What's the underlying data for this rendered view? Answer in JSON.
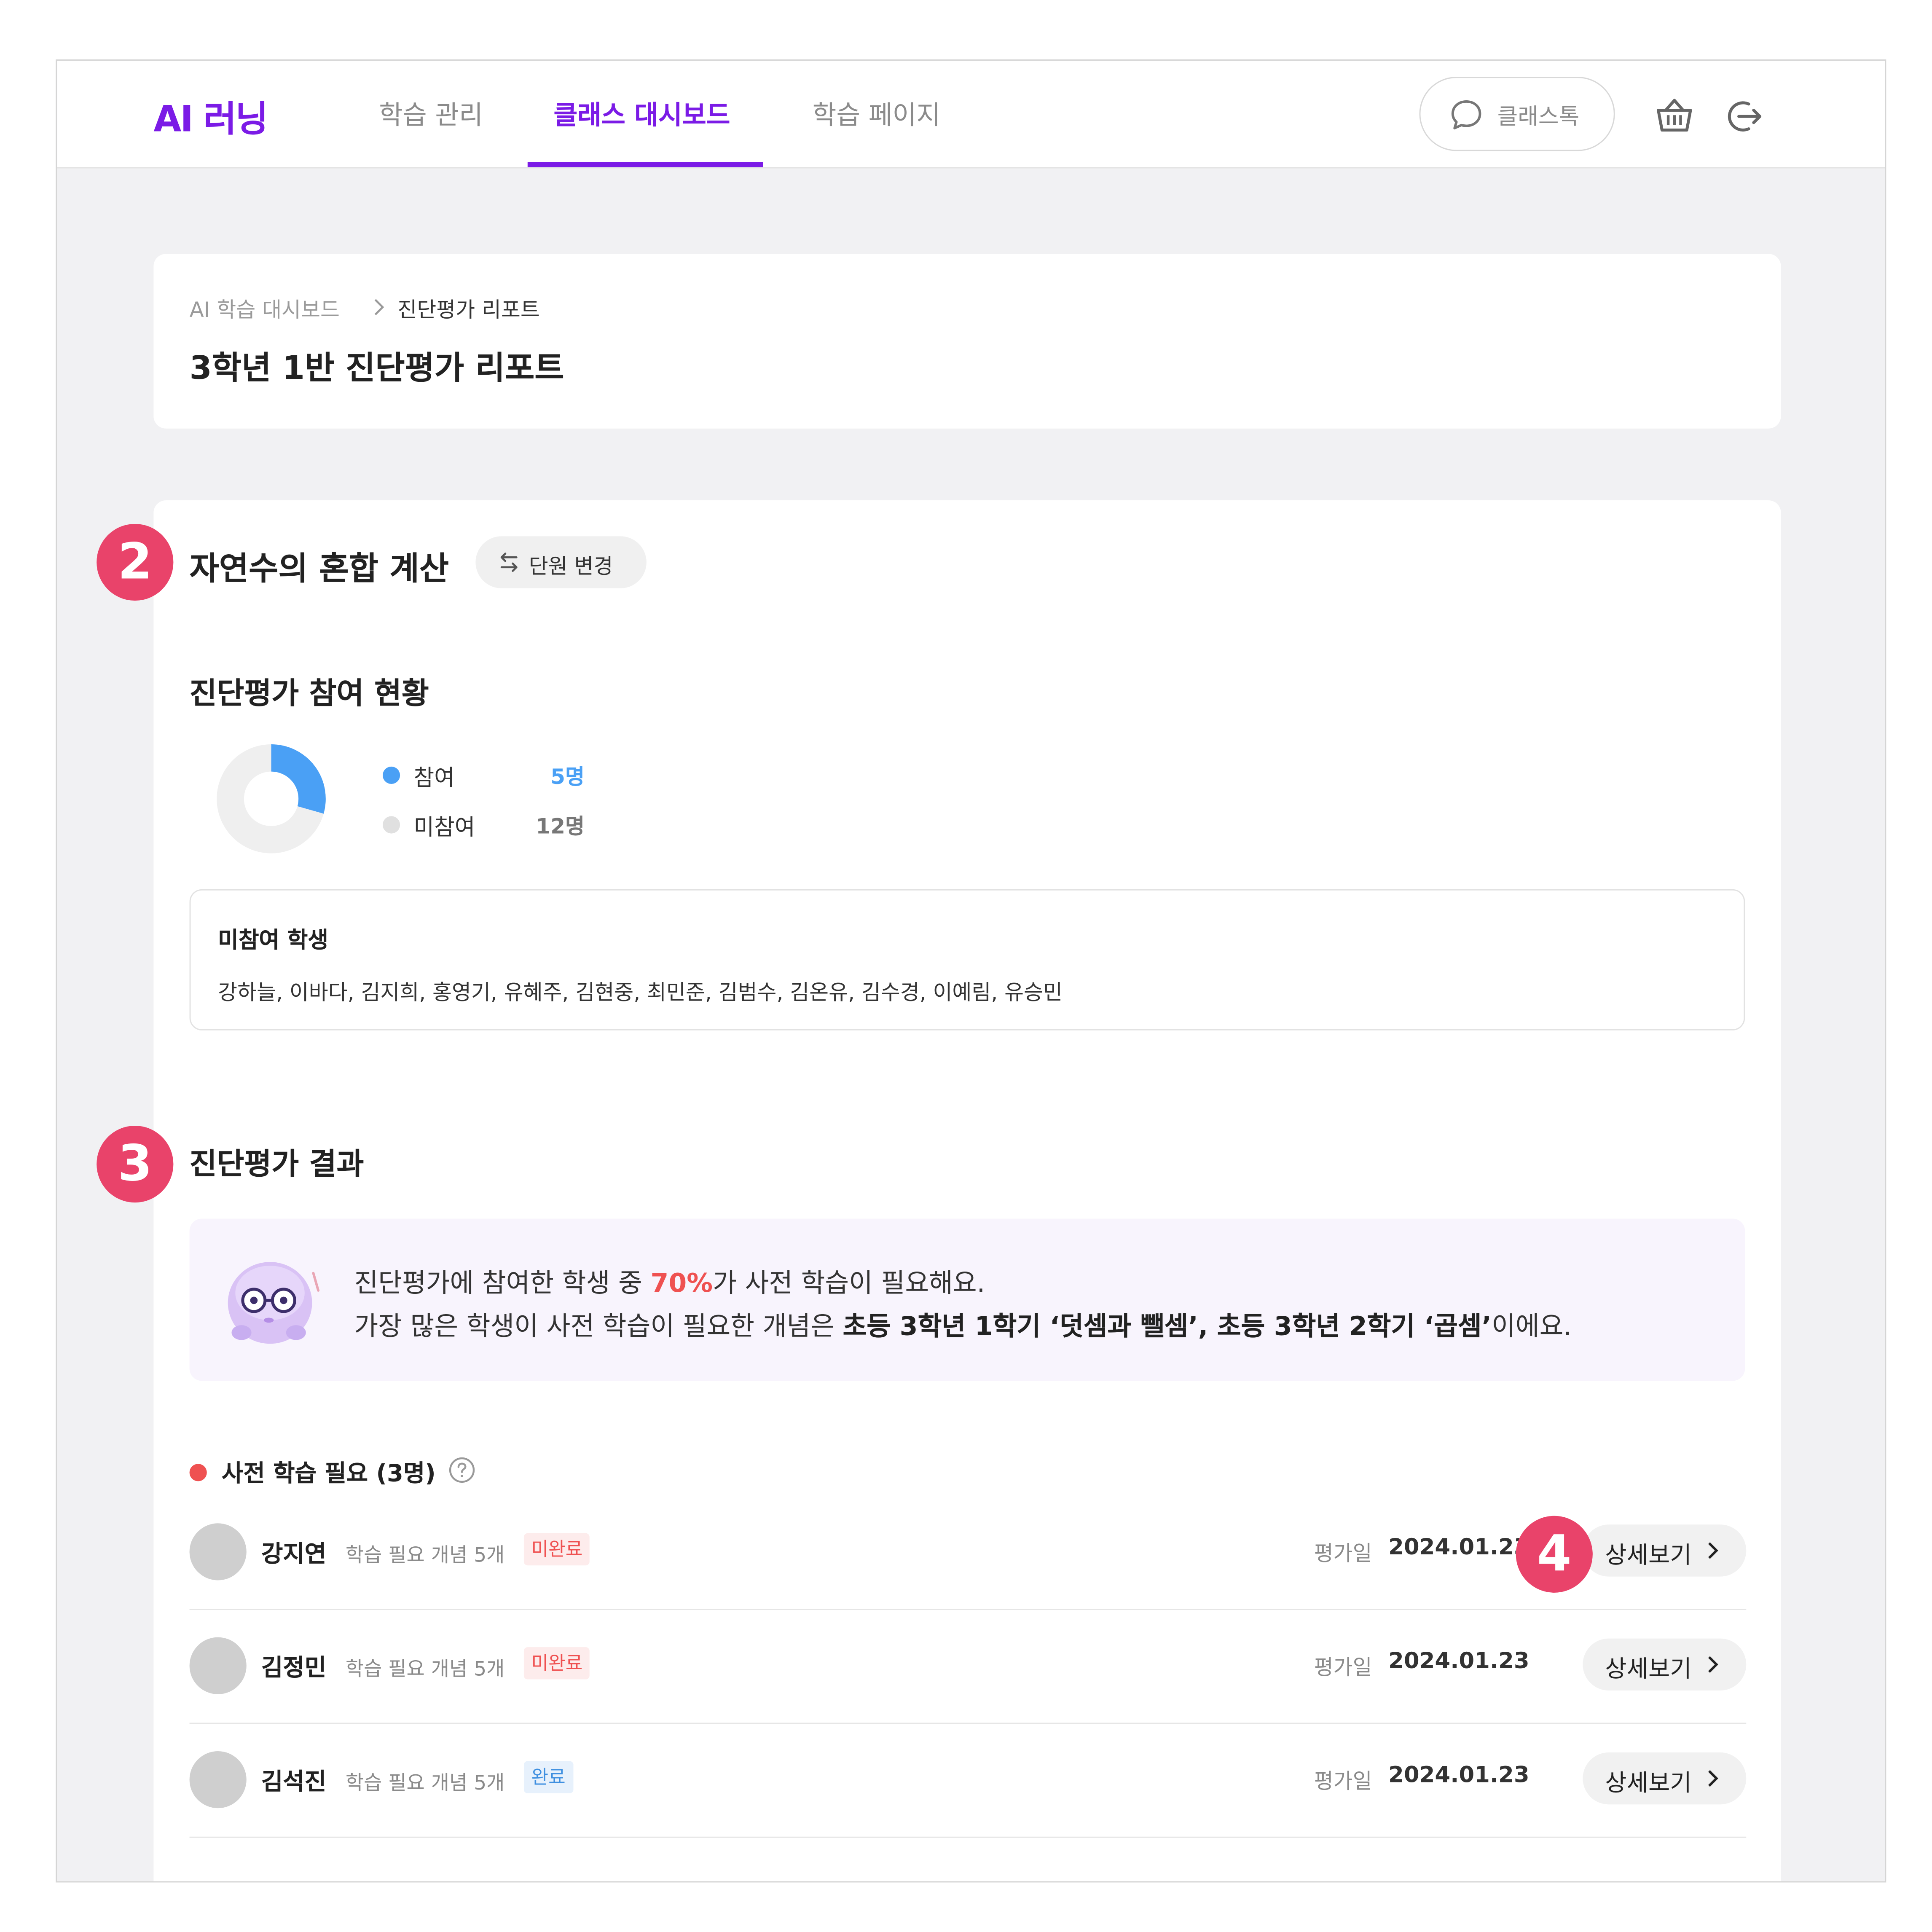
{
  "header": {
    "logo": "AI 러닝",
    "nav": [
      "학습 관리",
      "클래스 대시보드",
      "학습 페이지"
    ],
    "talk_label": "클래스톡",
    "accent_color": "#7b1be6"
  },
  "title_card": {
    "breadcrumb_root": "AI 학습 대시보드",
    "breadcrumb_current": "진단평가 리포트",
    "page_title": "3학년 1반 진단평가 리포트"
  },
  "unit": {
    "marker": "2",
    "title": "자연수의 혼합 계산",
    "change_label": "단원 변경"
  },
  "participation": {
    "title": "진단평가 참여 현황",
    "legend": [
      {
        "label": "참여",
        "value": "5명",
        "color": "#4aa0f5",
        "count": 5
      },
      {
        "label": "미참여",
        "value": "12명",
        "color": "#e0e0e0",
        "count": 12
      }
    ],
    "absent_title": "미참여 학생",
    "absent_list": "강하늘, 이바다, 김지희, 홍영기, 유혜주, 김현중, 최민준, 김범수, 김온유, 김수경, 이예림, 유승민"
  },
  "results": {
    "marker": "3",
    "title": "진단평가 결과",
    "banner_l1_pre": "진단평가에 참여한 학생 중 ",
    "banner_l1_pct": "70%",
    "banner_l1_post": "가 사전 학습이 필요해요.",
    "banner_l2_pre": "가장 많은 학생이 사전 학습이 필요한 개념은 ",
    "banner_l2_bold": "초등 3학년 1학기 ‘덧셈과 뺄셈’, 초등 3학년 2학기 ‘곱셈’",
    "banner_l2_post": "이에요.",
    "need_title": "사전 학습 필요 (3명)",
    "detail_marker": "4",
    "students": [
      {
        "name": "강지연",
        "info": "학습 필요 개념 5개",
        "status": "미완료",
        "date_label": "평가일",
        "date": "2024.01.23",
        "button": "상세보기"
      },
      {
        "name": "김정민",
        "info": "학습 필요 개념 5개",
        "status": "미완료",
        "date_label": "평가일",
        "date": "2024.01.23",
        "button": "상세보기"
      },
      {
        "name": "김석진",
        "info": "학습 필요 개념 5개",
        "status": "완료",
        "date_label": "평가일",
        "date": "2024.01.23",
        "button": "상세보기"
      }
    ]
  }
}
